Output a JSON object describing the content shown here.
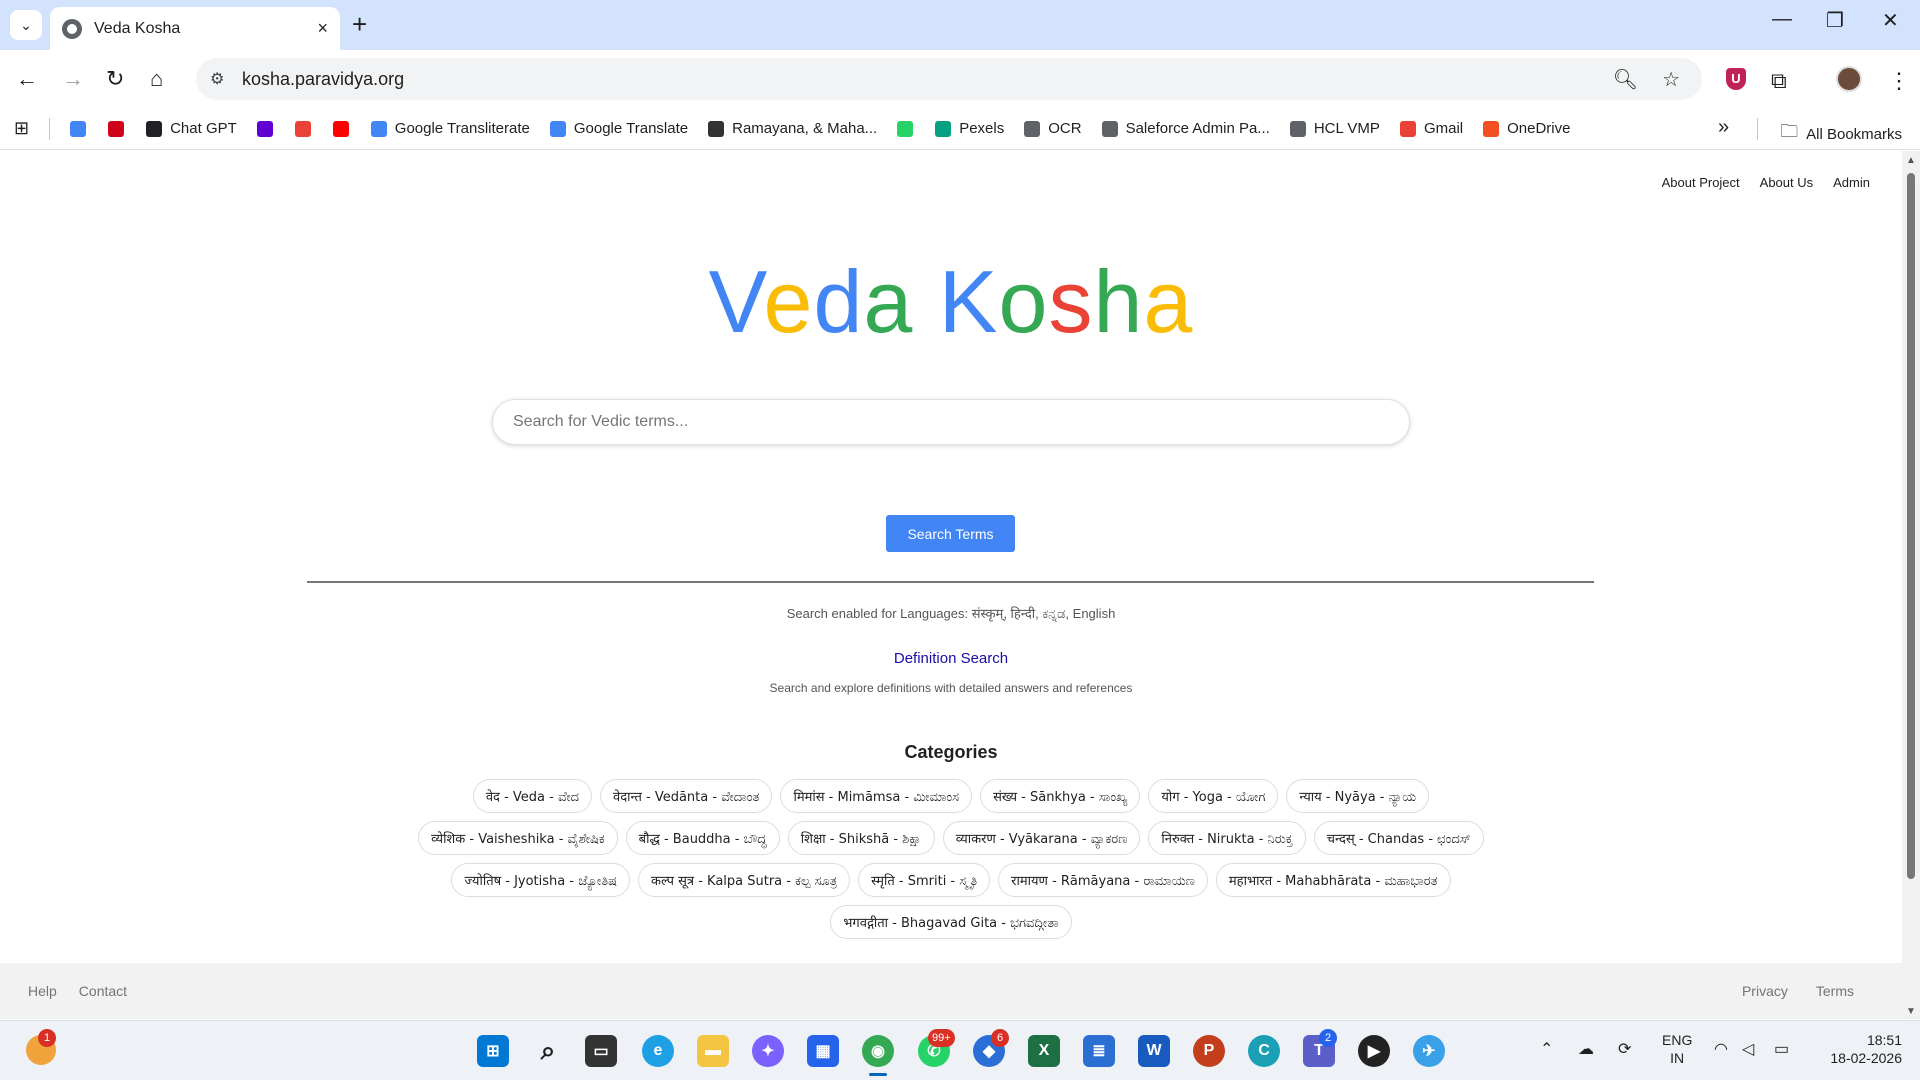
{
  "browser": {
    "tab_title": "Veda Kosha",
    "url": "kosha.paravidya.org",
    "new_tab": "+",
    "close_tab": "×",
    "bookmarks": [
      {
        "label": "",
        "icon": "google-icon",
        "color": "#4285f4"
      },
      {
        "label": "",
        "icon": "toi-icon",
        "color": "#d0021b"
      },
      {
        "label": "Chat GPT",
        "icon": "openai-icon",
        "color": "#202124"
      },
      {
        "label": "",
        "icon": "yahoo-icon",
        "color": "#6001d2"
      },
      {
        "label": "",
        "icon": "gmail-icon",
        "color": "#ea4335"
      },
      {
        "label": "",
        "icon": "youtube-icon",
        "color": "#ff0000"
      },
      {
        "label": "Google Transliterate",
        "icon": "google-icon",
        "color": "#4285f4"
      },
      {
        "label": "Google Translate",
        "icon": "translate-icon",
        "color": "#4285f4"
      },
      {
        "label": "Ramayana, & Maha...",
        "icon": "book-icon",
        "color": "#333333"
      },
      {
        "label": "",
        "icon": "whatsapp-icon",
        "color": "#25d366"
      },
      {
        "label": "Pexels",
        "icon": "pexels-icon",
        "color": "#05a081"
      },
      {
        "label": "OCR",
        "icon": "globe-icon",
        "color": "#5f6368"
      },
      {
        "label": "Saleforce Admin Pa...",
        "icon": "globe-icon",
        "color": "#5f6368"
      },
      {
        "label": "HCL VMP",
        "icon": "globe-icon",
        "color": "#5f6368"
      },
      {
        "label": "Gmail",
        "icon": "gmail-icon",
        "color": "#ea4335"
      },
      {
        "label": "OneDrive",
        "icon": "microsoft-icon",
        "color": "#f25022"
      }
    ],
    "all_bookmarks": "All Bookmarks"
  },
  "page": {
    "nav": [
      "About Project",
      "About Us",
      "Admin"
    ],
    "logo_letters": [
      {
        "ch": "V",
        "color": "#4285f4"
      },
      {
        "ch": "e",
        "color": "#fbbc05"
      },
      {
        "ch": "d",
        "color": "#4285f4"
      },
      {
        "ch": "a",
        "color": "#34a853"
      },
      {
        "ch": " ",
        "color": "#ffffff"
      },
      {
        "ch": "K",
        "color": "#4285f4"
      },
      {
        "ch": "o",
        "color": "#34a853"
      },
      {
        "ch": "s",
        "color": "#ea4335"
      },
      {
        "ch": "h",
        "color": "#34a853"
      },
      {
        "ch": "a",
        "color": "#fbbc05"
      }
    ],
    "search_placeholder": "Search for Vedic terms...",
    "search_button": "Search Terms",
    "languages_text": "Search enabled for Languages: संस्कृम्, हिन्दी, ಕನ್ನಡ, English",
    "definition_link": "Definition Search",
    "definition_desc": "Search and explore definitions with detailed answers and references",
    "categories_title": "Categories",
    "categories": [
      "वेद - Veda - ವೇದ",
      "वेदान्त - Vedānta - ವೇದಾಂತ",
      "मिमांस - Mimāmsa - ಮೀಮಾಂಸ",
      "संख्य - Sānkhya - ಸಾಂಖ್ಯ",
      "योग - Yoga - ಯೋಗ",
      "न्याय - Nyāya - ನ್ಯಾಯ",
      "व्येशिक - Vaisheshika - ವೈಶೇಷಿಕ",
      "बौद्ध - Bauddha - ಬೌದ್ಧ",
      "शिक्षा - Shikshā - ಶಿಕ್ಷಾ",
      "व्याकरण - Vyākarana - ವ್ಯಾಕರಣ",
      "निरुक्त - Nirukta - ನಿರುಕ್ತ",
      "चन्दस् - Chandas - ಛಂದಸ್",
      "ज्योतिष - Jyotisha - ಜ್ಯೋತಿಷ",
      "कल्प सूत्र - Kalpa Sutra - ಕಲ್ಪ ಸೂತ್ರ",
      "स्मृति - Smriti - ಸ್ಮೃತಿ",
      "रामायण - Rāmāyana - ರಾಮಾಯಣ",
      "महाभारत - Mahabhārata - ಮಹಾಭಾರತ",
      "भगवद्गीता - Bhagavad Gita - ಭಗವದ್ಗೀತಾ"
    ],
    "footer_left": [
      "Help",
      "Contact"
    ],
    "footer_right": [
      "Privacy",
      "Terms"
    ]
  },
  "taskbar": {
    "weather_badge": "1",
    "whatsapp_badge": "99+",
    "shield_badge": "6",
    "teams_badge": "2",
    "lang_line1": "ENG",
    "lang_line2": "IN",
    "time": "18:51",
    "date": "18-02-2026"
  }
}
